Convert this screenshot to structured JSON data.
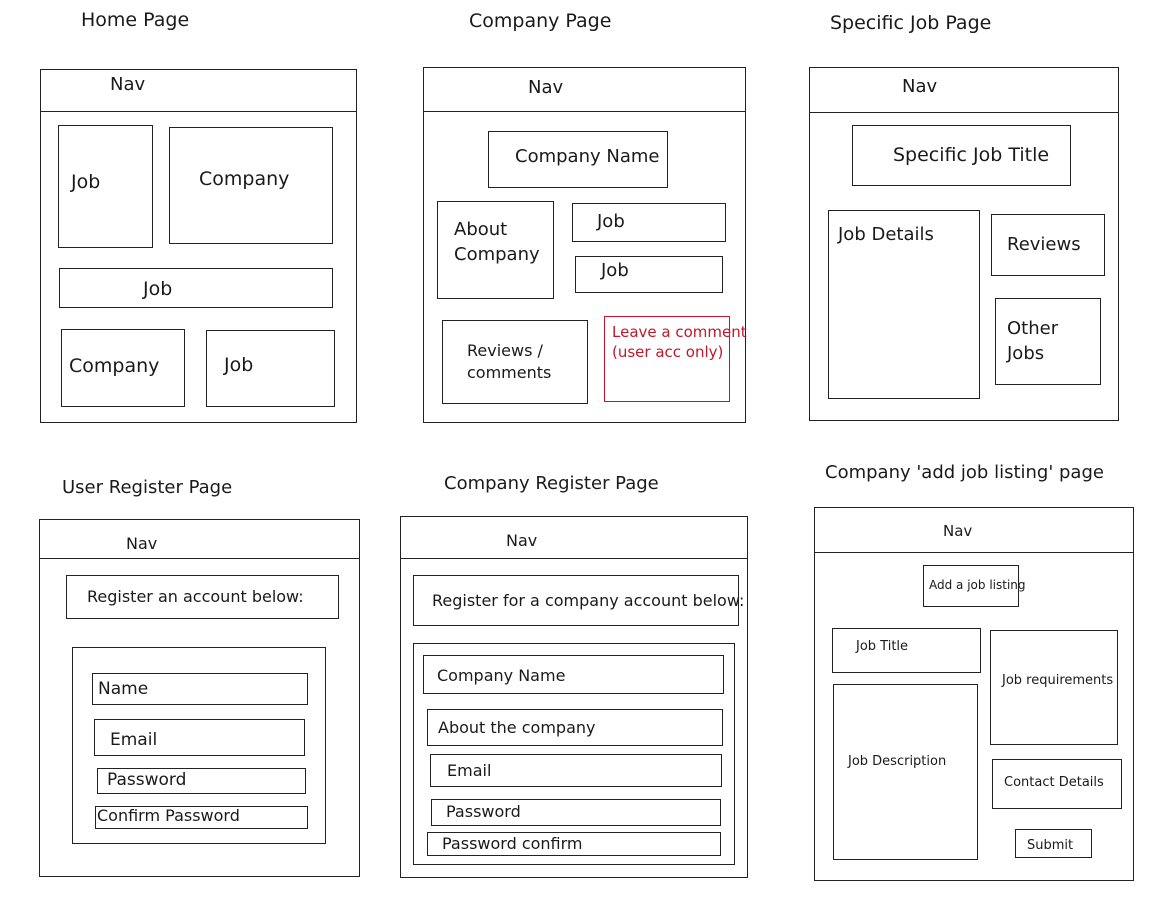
{
  "pages": {
    "home": {
      "title": "Home Page",
      "nav": "Nav",
      "job_1": "Job",
      "company_1": "Company",
      "job_2": "Job",
      "company_2": "Company",
      "job_3": "Job"
    },
    "company": {
      "title": "Company Page",
      "nav": "Nav",
      "company_name": "Company Name",
      "about_line1": "About",
      "about_line2": "Company",
      "job_1": "Job",
      "job_2": "Job",
      "reviews_line1": "Reviews /",
      "reviews_line2": "comments",
      "leave_comment_line1": "Leave a comment",
      "leave_comment_line2": "(user acc only)"
    },
    "specific_job": {
      "title": "Specific Job Page",
      "nav": "Nav",
      "job_title": "Specific Job Title",
      "job_details": "Job Details",
      "reviews": "Reviews",
      "other_jobs_line1": "Other",
      "other_jobs_line2": "Jobs"
    },
    "user_register": {
      "title": "User Register Page",
      "nav": "Nav",
      "heading": "Register an account below:",
      "fields": [
        "Name",
        "Email",
        "Password",
        "Confirm Password"
      ]
    },
    "company_register": {
      "title": "Company Register Page",
      "nav": "Nav",
      "heading": "Register for a company account below:",
      "fields": [
        "Company Name",
        "About the company",
        "Email",
        "Password",
        "Password confirm"
      ]
    },
    "add_job": {
      "title": "Company 'add job listing' page",
      "nav": "Nav",
      "heading": "Add a job listing",
      "job_title": "Job Title",
      "job_requirements": "Job requirements",
      "job_description": "Job Description",
      "contact_details": "Contact Details",
      "submit": "Submit"
    }
  },
  "colors": {
    "stroke": "#222222",
    "accent_red": "#c0182a"
  }
}
